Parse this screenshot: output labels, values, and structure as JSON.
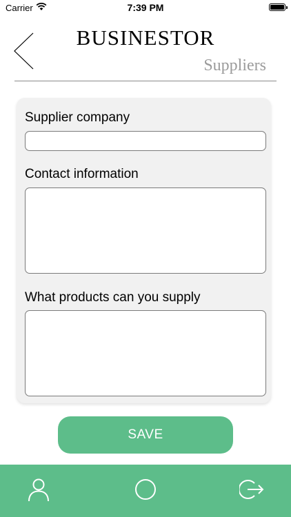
{
  "status_bar": {
    "carrier": "Carrier",
    "time": "7:39 PM"
  },
  "header": {
    "back_icon": "chevron-left-icon",
    "title": "BUSINESTOR",
    "subtitle": "Suppliers"
  },
  "form": {
    "fields": [
      {
        "label": "Supplier company",
        "value": "",
        "placeholder": ""
      },
      {
        "label": "Contact information",
        "value": "",
        "placeholder": ""
      },
      {
        "label": "What products can you supply",
        "value": "",
        "placeholder": ""
      }
    ],
    "save_label": "SAVE"
  },
  "tab_bar": {
    "items": [
      {
        "icon": "user-icon"
      },
      {
        "icon": "circle-icon"
      },
      {
        "icon": "logout-icon"
      }
    ]
  },
  "colors": {
    "accent": "#5dbd8a",
    "card_background": "#f1f1f1",
    "subtitle": "#9b9b9b"
  }
}
